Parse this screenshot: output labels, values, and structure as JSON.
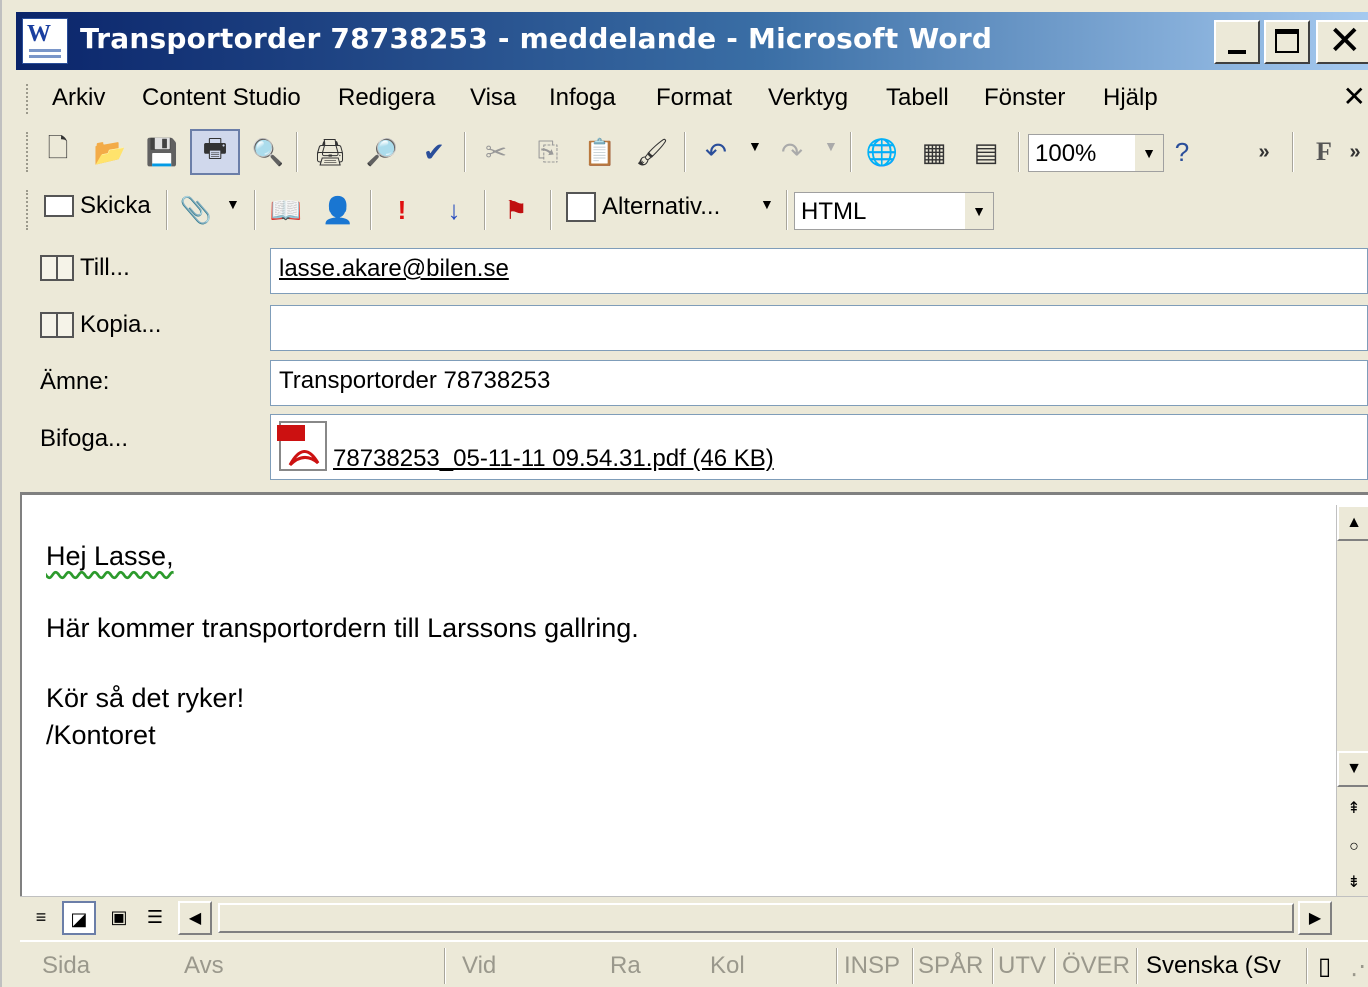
{
  "window": {
    "title": "Transportorder 78738253 - meddelande - Microsoft Word",
    "app_icon_letter": "W"
  },
  "menu": [
    "Arkiv",
    "Content Studio",
    "Redigera",
    "Visa",
    "Infoga",
    "Format",
    "Verktyg",
    "Tabell",
    "Fönster",
    "Hjälp"
  ],
  "standard_toolbar": {
    "zoom": "100%",
    "overflow": "»",
    "bold_glyph": "F"
  },
  "email_toolbar": {
    "send_label": "Skicka",
    "options_label": "Alternativ...",
    "format": "HTML"
  },
  "header": {
    "to_label": "Till...",
    "to_value": "lasse.akare@bilen.se",
    "cc_label": "Kopia...",
    "cc_value": "",
    "subject_label": "Ämne:",
    "subject_value": "Transportorder 78738253",
    "attach_label": "Bifoga...",
    "attachment": "78738253_05-11-11 09.54.31.pdf (46 KB)"
  },
  "body": {
    "greeting": "Hej Lasse,",
    "line1": "Här kommer transportordern till Larssons gallring.",
    "line2": "Kör så det ryker!",
    "line3": "/Kontoret"
  },
  "status": {
    "page": "Sida",
    "section": "Avs",
    "at": "Vid",
    "line": "Ra",
    "col": "Kol",
    "rec": "INSP",
    "trk": "SPÅR",
    "ext": "UTV",
    "ovr": "ÖVER",
    "language": "Svenska (Sv"
  }
}
